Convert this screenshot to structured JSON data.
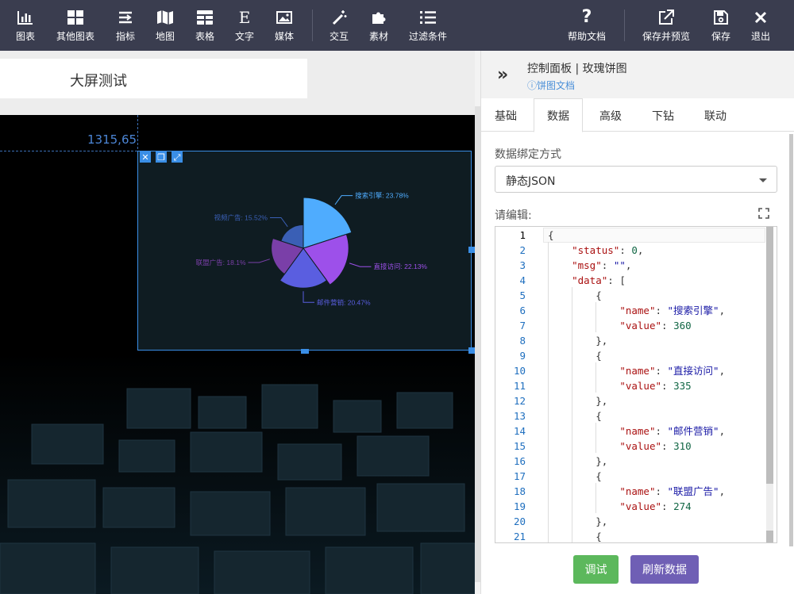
{
  "toolbar": {
    "left_items": [
      {
        "label": "图表",
        "icon": "bar-chart-icon"
      },
      {
        "label": "其他图表",
        "icon": "grid-icon"
      },
      {
        "label": "指标",
        "icon": "indicator-icon"
      },
      {
        "label": "地图",
        "icon": "map-icon"
      },
      {
        "label": "表格",
        "icon": "table-icon"
      },
      {
        "label": "文字",
        "icon": "text-icon"
      },
      {
        "label": "媒体",
        "icon": "image-icon"
      }
    ],
    "mid_items": [
      {
        "label": "交互",
        "icon": "magic-wand-icon"
      },
      {
        "label": "素材",
        "icon": "puzzle-icon"
      },
      {
        "label": "过滤条件",
        "icon": "list-icon"
      }
    ],
    "right_items": [
      {
        "label": "帮助文档",
        "icon": "question-icon"
      },
      {
        "label": "保存并预览",
        "icon": "external-link-icon"
      },
      {
        "label": "保存",
        "icon": "save-icon"
      },
      {
        "label": "退出",
        "icon": "close-icon"
      }
    ]
  },
  "canvas": {
    "title": "大屏测试",
    "coord_readout": "1315,65",
    "widget_tools": [
      "close-icon",
      "copy-icon",
      "expand-icon"
    ]
  },
  "chart_data": {
    "type": "pie",
    "subtype": "rose",
    "title": "",
    "slices": [
      {
        "name": "搜索引擎",
        "value": 360,
        "percent": "23.78%",
        "color": "#4facfe"
      },
      {
        "name": "直接访问",
        "value": 335,
        "percent": "22.13%",
        "color": "#9d50ea"
      },
      {
        "name": "邮件营销",
        "value": 310,
        "percent": "20.47%",
        "color": "#5a5ee0"
      },
      {
        "name": "联盟广告",
        "value": 274,
        "percent": "18.1%",
        "color": "#7a3fa8"
      },
      {
        "name": "视频广告",
        "value": 235,
        "percent": "15.52%",
        "color": "#3a5fb5"
      }
    ],
    "labels": [
      "搜索引擎: 23.78%",
      "直接访问: 22.13%",
      "邮件营销: 20.47%",
      "联盟广告: 18.1%",
      "视频广告: 15.52%"
    ]
  },
  "panel": {
    "title": "控制面板 | 玫瑰饼图",
    "doc_link": "饼图文档",
    "tabs": [
      "基础",
      "数据",
      "高级",
      "下钻",
      "联动"
    ],
    "active_tab": "数据",
    "binding_label": "数据绑定方式",
    "binding_value": "静态JSON",
    "editor_label": "请编辑:",
    "buttons": {
      "debug": "调试",
      "refresh": "刷新数据"
    }
  },
  "editor": {
    "line_numbers": [
      "1",
      "2",
      "3",
      "4",
      "5",
      "6",
      "7",
      "8",
      "9",
      "10",
      "11",
      "12",
      "13",
      "14",
      "15",
      "16",
      "17",
      "18",
      "19",
      "20",
      "21"
    ],
    "current_line": 1
  }
}
